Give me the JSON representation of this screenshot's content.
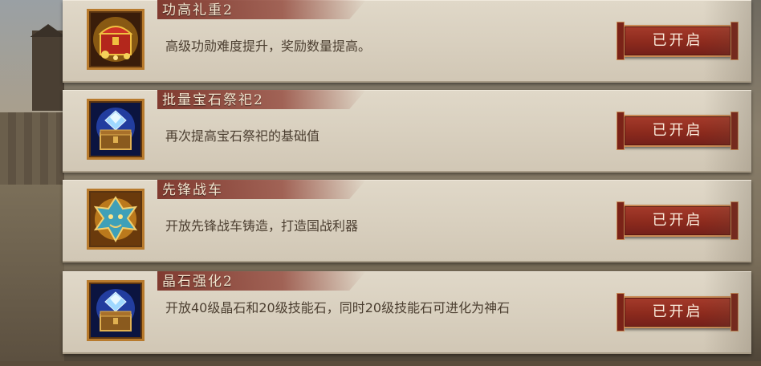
{
  "items": [
    {
      "title": "功高礼重2",
      "description": "高级功勋难度提升，奖励数量提高。",
      "status": "已开启",
      "icon": "treasure-chest-icon"
    },
    {
      "title": "批量宝石祭祀2",
      "description": "再次提高宝石祭祀的基础值",
      "status": "已开启",
      "icon": "gem-box-icon"
    },
    {
      "title": "先锋战车",
      "description": "开放先锋战车铸造，打造国战利器",
      "status": "已开启",
      "icon": "dragon-emblem-icon"
    },
    {
      "title": "晶石强化2",
      "description": "开放40级晶石和20级技能石，同时20级技能石可进化为神石",
      "status": "已开启",
      "icon": "gem-box-icon"
    }
  ],
  "colors": {
    "card_bg": "#d8cfbe",
    "banner": "#8c3c30",
    "button": "#8c2a1d",
    "button_border": "#c98a55",
    "text": "#4b3e30"
  }
}
